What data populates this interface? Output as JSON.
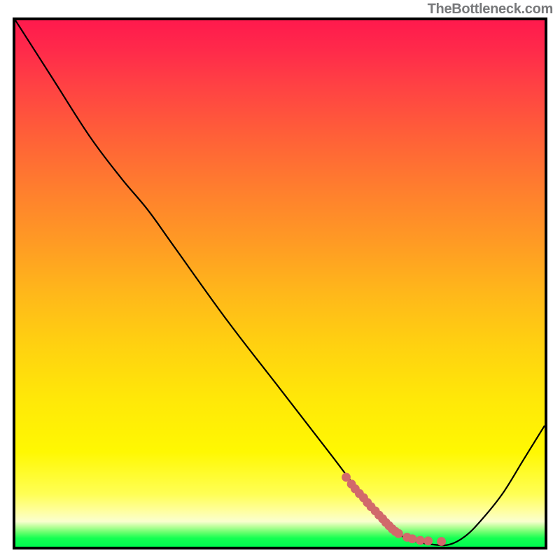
{
  "attribution": "TheBottleneck.com",
  "chart_data": {
    "type": "line",
    "title": "",
    "xlabel": "",
    "ylabel": "",
    "xlim": [
      0,
      100
    ],
    "ylim": [
      0,
      100
    ],
    "series": [
      {
        "name": "curve",
        "x": [
          0,
          7,
          14,
          20,
          25,
          30,
          40,
          50,
          60,
          66,
          70,
          73,
          76,
          79,
          82,
          85,
          88,
          92,
          96,
          100
        ],
        "y": [
          100,
          89,
          78,
          70,
          64,
          57,
          43,
          30,
          17,
          9,
          4.2,
          2.0,
          0.9,
          0.4,
          0.4,
          2.0,
          5.0,
          10,
          16.5,
          23
        ]
      },
      {
        "name": "dots",
        "x": [
          62.5,
          63.5,
          64.2,
          65.0,
          65.8,
          66.5,
          67.2,
          68.0,
          68.7,
          69.4,
          70.0,
          70.6,
          71.2,
          71.8,
          72.4,
          74.0,
          75.0,
          76.5,
          78.0,
          80.5
        ],
        "y": [
          13.2,
          11.9,
          11.0,
          10.1,
          9.3,
          8.4,
          7.6,
          6.8,
          6.0,
          5.3,
          4.6,
          4.0,
          3.4,
          2.9,
          2.5,
          1.8,
          1.5,
          1.2,
          1.1,
          1.0
        ]
      }
    ],
    "colors": {
      "curve": "#000000",
      "dots": "#d1696b"
    }
  }
}
